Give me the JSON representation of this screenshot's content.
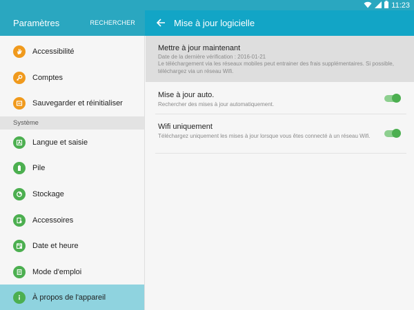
{
  "status_bar": {
    "time": "11:23"
  },
  "left_header": {
    "title": "Paramètres",
    "search_label": "RECHERCHER"
  },
  "right_header": {
    "title": "Mise à jour logicielle"
  },
  "sidebar": {
    "items_top": [
      {
        "label": "Accessibilité",
        "icon": "hand-icon",
        "color": "#f09a1d"
      },
      {
        "label": "Comptes",
        "icon": "key-icon",
        "color": "#f09a1d"
      },
      {
        "label": "Sauvegarder et réinitialiser",
        "icon": "backup-icon",
        "color": "#f09a1d"
      }
    ],
    "section_label": "Système",
    "items_system": [
      {
        "label": "Langue et saisie",
        "icon": "language-icon",
        "color": "#4caf50"
      },
      {
        "label": "Pile",
        "icon": "battery-icon",
        "color": "#4caf50"
      },
      {
        "label": "Stockage",
        "icon": "storage-icon",
        "color": "#4caf50"
      },
      {
        "label": "Accessoires",
        "icon": "accessory-icon",
        "color": "#4caf50"
      },
      {
        "label": "Date et heure",
        "icon": "calendar-icon",
        "color": "#4caf50"
      },
      {
        "label": "Mode d'emploi",
        "icon": "manual-icon",
        "color": "#4caf50"
      },
      {
        "label": "À propos de l'appareil",
        "icon": "info-icon",
        "color": "#4caf50"
      }
    ]
  },
  "content": {
    "update_now": {
      "title": "Mettre à jour maintenant",
      "last_check": "Date de la dernière vérification : 2016-01-21",
      "note": "Le téléchargement via les réseaux mobiles peut entrainer des frais supplémentaires. Si possible, téléchargez via un réseau Wifi."
    },
    "auto_update": {
      "title": "Mise à jour auto.",
      "subtitle": "Rechercher des mises à jour automatiquement.",
      "enabled": true
    },
    "wifi_only": {
      "title": "Wifi uniquement",
      "subtitle": "Téléchargez uniquement les mises à jour lorsque vous êtes connecté à un réseau Wifi.",
      "enabled": true
    }
  },
  "colors": {
    "header": "#2aa7c0",
    "accent": "#12a5c6",
    "active_item": "#8fd3df",
    "toggle_on": "#4caf50",
    "orange_icon": "#f09a1d"
  }
}
